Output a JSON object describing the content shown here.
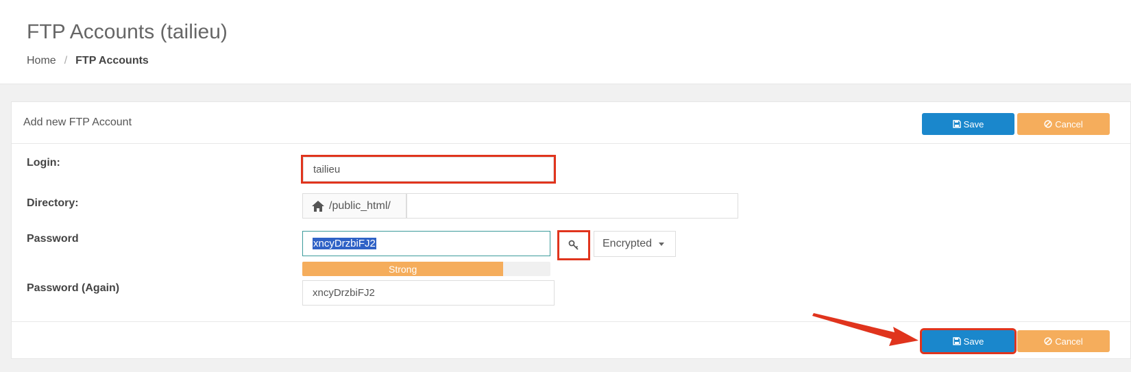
{
  "header": {
    "title": "FTP Accounts (tailieu)",
    "breadcrumb": {
      "home": "Home",
      "separator": "/",
      "current": "FTP Accounts"
    }
  },
  "panel": {
    "title": "Add new FTP Account",
    "save_label": "Save",
    "cancel_label": "Cancel"
  },
  "form": {
    "login_label": "Login:",
    "login_value": "tailieu",
    "directory_label": "Directory:",
    "directory_prefix": "/public_html/",
    "directory_value": "",
    "password_label": "Password",
    "password_value": "xncyDrzbiFJ2",
    "password_again_label": "Password (Again)",
    "password_again_value": "xncyDrzbiFJ2",
    "strength_label": "Strong",
    "strength_percent": 81,
    "encryption_selected": "Encrypted"
  },
  "colors": {
    "primary": "#1a87cc",
    "warning": "#f5ad5c",
    "highlight": "#e0341d"
  }
}
